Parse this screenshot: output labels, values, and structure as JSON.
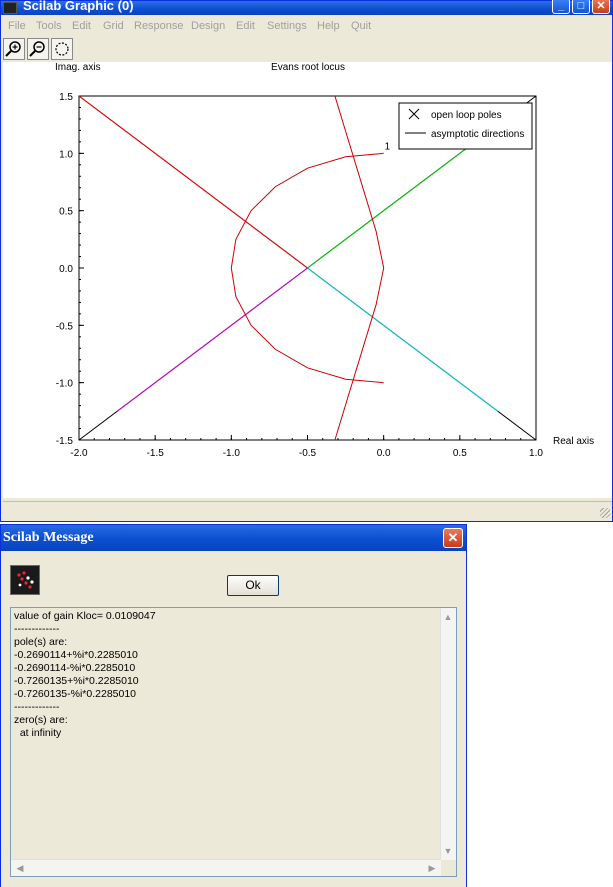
{
  "graphic_window": {
    "title": "Scilab Graphic (0)",
    "menu": [
      "File",
      "Tools",
      "Edit",
      "Grid",
      "Response",
      "Design",
      "Edit",
      "Settings",
      "Help",
      "Quit"
    ],
    "toolbar": {
      "zoom_in_icon": "zoom-in-icon",
      "zoom_out_icon": "zoom-out-icon",
      "rotate_icon": "rotate-icon"
    },
    "colors": {
      "titlebar": "#0a4fd1",
      "menu_disabled": "#a0a0a0"
    }
  },
  "chart_data": {
    "type": "line",
    "title": "Evans root locus",
    "xlabel": "Real axis",
    "ylabel": "Imag. axis",
    "xlim": [
      -2.0,
      1.0
    ],
    "ylim": [
      -1.5,
      1.5
    ],
    "x_ticks": [
      "-2.0",
      "-1.5",
      "-1.0",
      "-0.5",
      "0.0",
      "0.5",
      "1.0"
    ],
    "y_ticks": [
      "1.5",
      "1.0",
      "0.5",
      "0.0",
      "-0.5",
      "-1.0",
      "-1.5"
    ],
    "legend": {
      "position": "top-right",
      "entries": [
        "open loop poles",
        "asymptotic directions"
      ]
    },
    "curve_label": "1",
    "series": [
      {
        "color": "#000000",
        "points": [
          [
            -2.0,
            1.5
          ],
          [
            -0.5,
            0.0
          ],
          [
            1.0,
            -1.5
          ]
        ]
      },
      {
        "color": "#000000",
        "points": [
          [
            -2.0,
            -1.5
          ],
          [
            -0.5,
            0.0
          ],
          [
            1.0,
            1.5
          ]
        ]
      },
      {
        "color": "#ff0000",
        "points": [
          [
            -2.0,
            1.5
          ],
          [
            -0.5,
            0.0
          ]
        ]
      },
      {
        "color": "#00cc00",
        "points": [
          [
            -0.5,
            0.0
          ],
          [
            0.6,
            1.1
          ]
        ]
      },
      {
        "color": "#cc00cc",
        "points": [
          [
            -0.5,
            0.0
          ],
          [
            -1.75,
            -1.25
          ]
        ]
      },
      {
        "color": "#00cccc",
        "points": [
          [
            -0.5,
            0.0
          ],
          [
            0.75,
            -1.25
          ]
        ]
      },
      {
        "color": "#cc0000",
        "name": "1",
        "points": [
          [
            0.0,
            1.0
          ],
          [
            -0.25,
            0.97
          ],
          [
            -0.5,
            0.87
          ],
          [
            -0.71,
            0.71
          ],
          [
            -0.87,
            0.5
          ],
          [
            -0.97,
            0.25
          ],
          [
            -1.0,
            0.0
          ],
          [
            -0.97,
            -0.25
          ],
          [
            -0.87,
            -0.5
          ],
          [
            -0.71,
            -0.71
          ],
          [
            -0.5,
            -0.87
          ],
          [
            -0.25,
            -0.97
          ],
          [
            0.0,
            -1.0
          ]
        ]
      },
      {
        "color": "#cc0000",
        "points": [
          [
            -0.32,
            1.5
          ],
          [
            -0.05,
            0.32
          ],
          [
            0.0,
            0.0
          ],
          [
            -0.05,
            -0.32
          ],
          [
            -0.32,
            -1.5
          ]
        ]
      }
    ]
  },
  "message_dialog": {
    "title": "Scilab Message",
    "ok_label": "Ok",
    "message": "value of gain Kloc= 0.0109047\n-------------\npole(s) are:\n-0.2690114+%i*0.2285010\n-0.2690114-%i*0.2285010\n-0.7260135+%i*0.2285010\n-0.7260135-%i*0.2285010\n-------------\nzero(s) are:\n  at infinity"
  }
}
